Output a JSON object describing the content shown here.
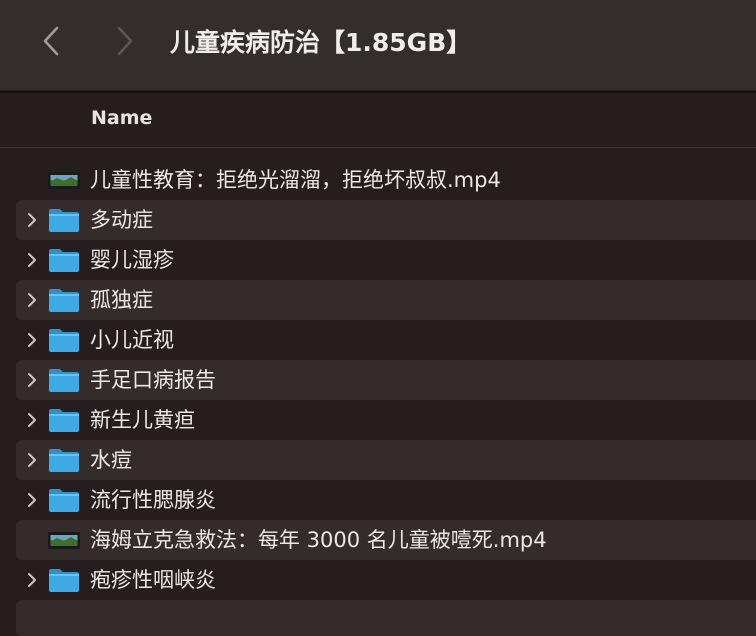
{
  "window": {
    "title": "儿童疾病防治【1.85GB】"
  },
  "toolbar": {
    "back_icon": "chevron-left-icon",
    "forward_icon": "chevron-right-icon"
  },
  "columns": {
    "name": "Name"
  },
  "colors": {
    "folder": "#3fa9e6",
    "background": "#261e1e",
    "alt_row": "#342b2b",
    "titlebar": "#342d2d"
  },
  "items": [
    {
      "name": "儿童性教育：拒绝光溜溜，拒绝坏叔叔.mp4",
      "kind": "video"
    },
    {
      "name": "多动症",
      "kind": "folder"
    },
    {
      "name": "婴儿湿疹",
      "kind": "folder"
    },
    {
      "name": "孤独症",
      "kind": "folder"
    },
    {
      "name": "小儿近视",
      "kind": "folder"
    },
    {
      "name": "手足口病报告",
      "kind": "folder"
    },
    {
      "name": "新生儿黄疸",
      "kind": "folder"
    },
    {
      "name": "水痘",
      "kind": "folder"
    },
    {
      "name": "流行性腮腺炎",
      "kind": "folder"
    },
    {
      "name": "海姆立克急救法：每年 3000 名儿童被噎死.mp4",
      "kind": "video"
    },
    {
      "name": "疱疹性咽峡炎",
      "kind": "folder"
    }
  ]
}
